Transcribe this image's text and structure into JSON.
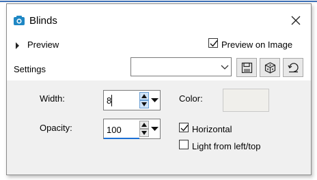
{
  "window": {
    "title": "Blinds",
    "icons": {
      "app": "camera-icon",
      "close": "close-icon"
    }
  },
  "preview": {
    "label": "Preview",
    "collapsed": true
  },
  "preview_on_image": {
    "label": "Preview on Image",
    "checked": true
  },
  "settings": {
    "label": "Settings",
    "preset_value": "",
    "buttons": [
      "save-preset-icon",
      "random-dice-icon",
      "reset-default-icon"
    ]
  },
  "width": {
    "label": "Width:",
    "value": "8"
  },
  "opacity": {
    "label": "Opacity:",
    "value": "100"
  },
  "color": {
    "label": "Color:",
    "swatch_hex": "#f0efeb"
  },
  "horizontal": {
    "label": "Horizontal",
    "checked": true
  },
  "light_from_left_top": {
    "label": "Light from left/top",
    "checked": false
  },
  "colors": {
    "dialog_bg": "#f0f0f0",
    "accent": "#1a6fd6",
    "icon_blue": "#1f87c4"
  }
}
